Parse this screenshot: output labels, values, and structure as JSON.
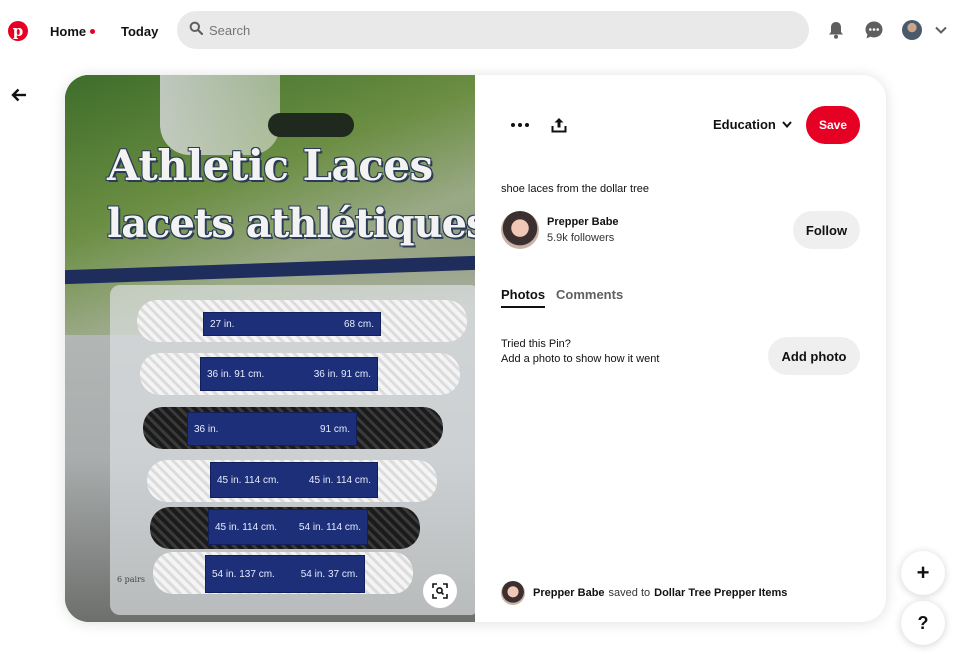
{
  "topbar": {
    "logo_letter": "p",
    "home_label": "Home",
    "today_label": "Today",
    "search_placeholder": "Search"
  },
  "pin": {
    "package_title_en": "Athletic Laces",
    "package_title_fr": "lacets athlétiques",
    "package_count": "6 pairs",
    "laces": [
      {
        "color": "white",
        "left": "27 in.",
        "right": "68 cm."
      },
      {
        "color": "white",
        "left": "36 in.  91 cm.",
        "right": "36 in.  91 cm."
      },
      {
        "color": "black",
        "left": "36 in.",
        "right": "91 cm."
      },
      {
        "color": "white",
        "left": "45 in.  114 cm.",
        "right": "45 in.  114 cm."
      },
      {
        "color": "black",
        "left": "45 in.  114 cm.",
        "right": "54 in.  114 cm."
      },
      {
        "color": "white",
        "left": "54 in.  137 cm.",
        "right": "54 in.  37 cm."
      }
    ]
  },
  "panel": {
    "board_name": "Education",
    "save_label": "Save",
    "description": "shoe laces from the dollar tree",
    "creator_name": "Prepper Babe",
    "creator_followers": "5.9k followers",
    "follow_label": "Follow",
    "tabs": [
      {
        "label": "Photos",
        "active": true
      },
      {
        "label": "Comments",
        "active": false
      }
    ],
    "tried_title": "Tried this Pin?",
    "tried_subtitle": "Add a photo to show how it went",
    "add_photo_label": "Add photo",
    "saved_by": "Prepper Babe",
    "saved_to_text": "saved to",
    "saved_board": "Dollar Tree Prepper Items"
  },
  "floating": {
    "plus_label": "+",
    "help_label": "?"
  },
  "colors": {
    "brand": "#e60023",
    "button_gray": "#efefef",
    "search_bg": "#e9e9e9"
  }
}
